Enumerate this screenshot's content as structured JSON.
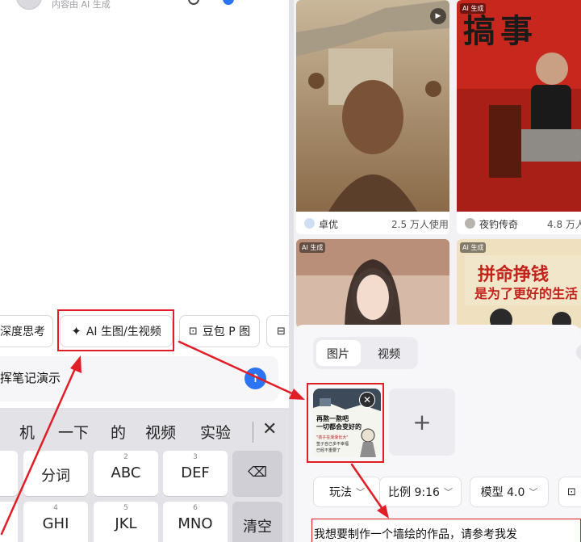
{
  "left": {
    "ai_note": "内容由 AI 生成",
    "chips": {
      "deep_think": "深度思考",
      "ai_generate": "AI 生图/生视频",
      "doubao_p": "豆包 P 图"
    },
    "input_text": "挥笔记演示",
    "candidates": [
      "机",
      "一下",
      "的",
      "视频",
      "实验"
    ],
    "keys": [
      {
        "num": "",
        "label": "分词"
      },
      {
        "num": "2",
        "label": "ABC"
      },
      {
        "num": "3",
        "label": "DEF"
      },
      {
        "num": "4",
        "label": "GHI"
      },
      {
        "num": "5",
        "label": "JKL"
      },
      {
        "num": "6",
        "label": "MNO"
      },
      {
        "num": "",
        "label": "清空"
      }
    ]
  },
  "right": {
    "cards": [
      {
        "badge": "",
        "author": "卓优",
        "count": "2.5 万人使用"
      },
      {
        "badge": "AI 生成",
        "author": "夜钓传奇",
        "count": "4.8 万人"
      },
      {
        "badge": "AI 生成"
      },
      {
        "badge": "AI 生成",
        "banner_line1": "拼命挣钱",
        "banner_line2": "是为了更好的生活"
      }
    ],
    "card2_title": "搞事",
    "tabs": {
      "image": "图片",
      "video": "视频"
    },
    "thumb_text": {
      "line1": "再熬一熬吧",
      "line2": "一切都会变好的",
      "line3": "\"孩子在渐渐长大\"",
      "line4": "签子自己多不幸福",
      "line5": "已经不重要了"
    },
    "add_symbol": "+",
    "options": {
      "mode": "玩法",
      "ratio": "比例 9:16",
      "model": "模型 4.0"
    },
    "prompt": "我想要制作一个墙绘的作品，请参考我发"
  },
  "colors": {
    "accent_red": "#e11d26",
    "send_blue": "#2d73f5"
  }
}
